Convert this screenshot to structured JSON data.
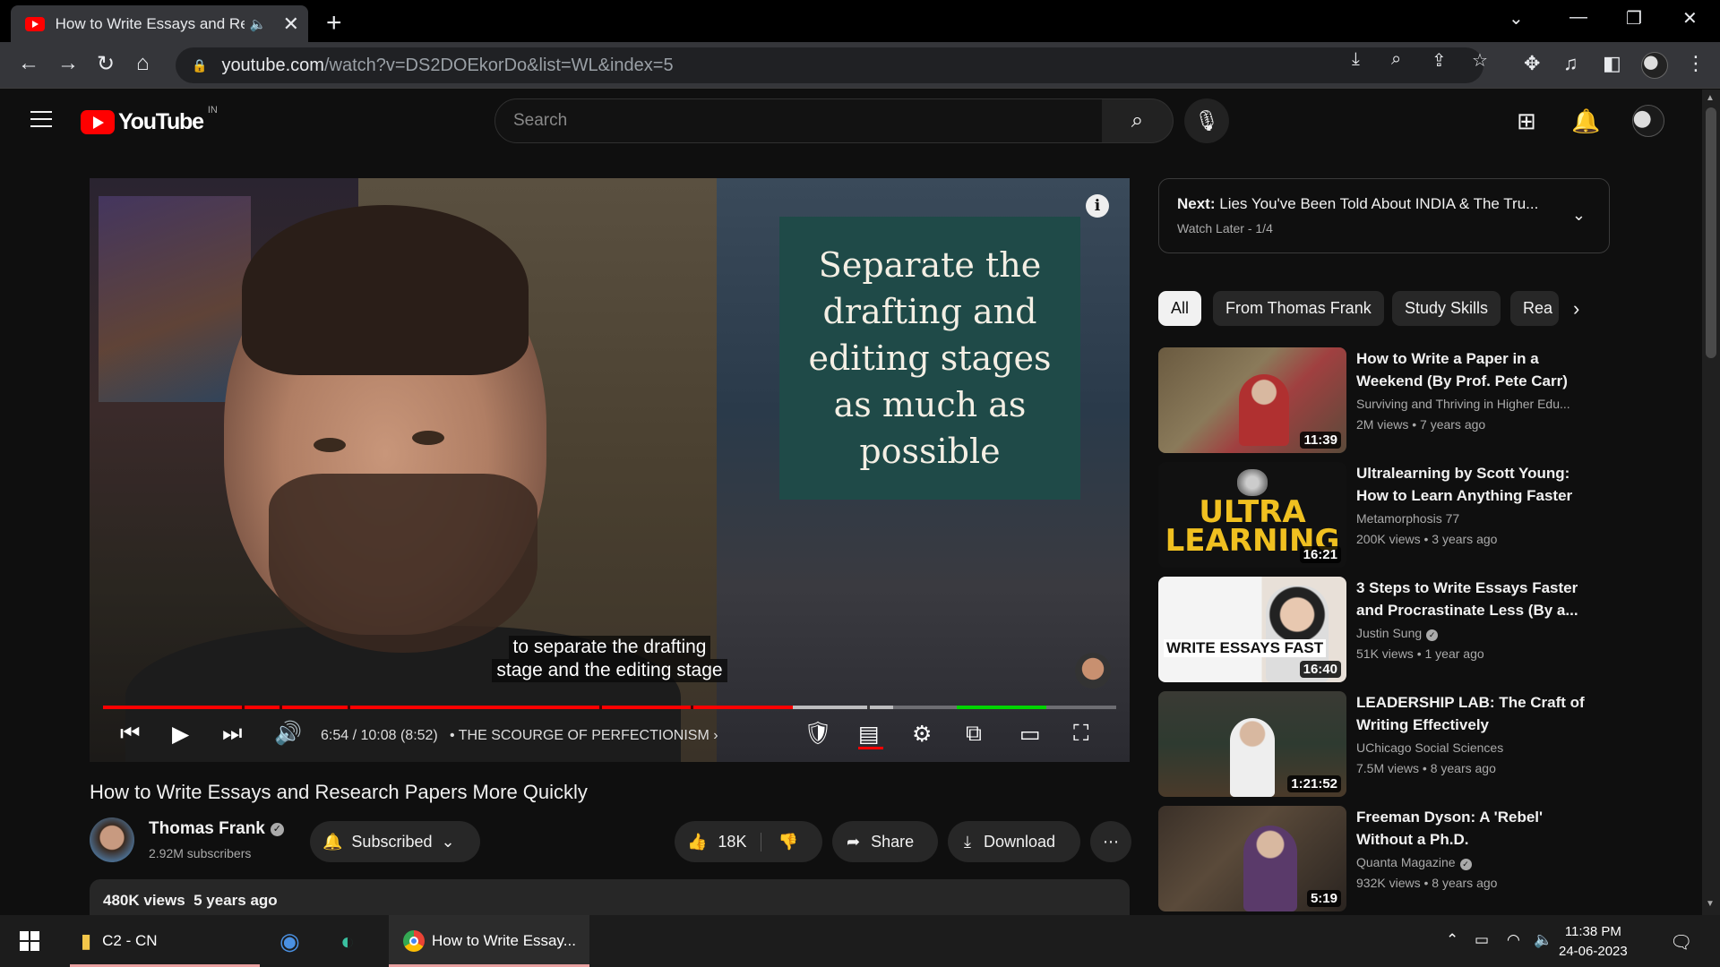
{
  "browser": {
    "tab_title": "How to Write Essays and Resear",
    "url_host": "youtube.com",
    "url_path": "/watch?v=DS2DOEkorDo&list=WL&index=5"
  },
  "youtube": {
    "logo_text": "YouTube",
    "country_code": "IN",
    "search_placeholder": "Search"
  },
  "player": {
    "quote": "Separate the drafting and editing stages as much as possible",
    "caption_line1": "to separate the drafting",
    "caption_line2": "stage and the editing stage",
    "timecode": "6:54 / 10:08 (8:52)",
    "chapter": "• THE SCOURGE OF PERFECTIONISM",
    "progress_fraction": 0.681,
    "loaded_fraction": 0.78
  },
  "video": {
    "title": "How to Write Essays and Research Papers More Quickly",
    "channel": "Thomas Frank",
    "subscribers": "2.92M subscribers",
    "subscribed_label": "Subscribed",
    "likes": "18K",
    "share_label": "Share",
    "download_label": "Download",
    "views_age": "480K views  5 years ago"
  },
  "playlist": {
    "next_prefix": "Next:",
    "next_title": "Lies You've Been Told About INDIA & The Tru...",
    "sub": "Watch Later - 1/4"
  },
  "chips": [
    "All",
    "From Thomas Frank",
    "Study Skills",
    "Rea"
  ],
  "recommendations": [
    {
      "title": "How to Write a Paper in a Weekend (By Prof. Pete Carr)",
      "channel": "Surviving and Thriving in Higher Edu...",
      "meta": "2M views  • 7 years ago",
      "duration": "11:39"
    },
    {
      "title": "Ultralearning by Scott Young: How to Learn Anything Faster",
      "channel": "Metamorphosis 77",
      "meta": "200K views  • 3 years ago",
      "duration": "16:21",
      "thumb_text": "ULTRA LEARNING"
    },
    {
      "title": "3 Steps to Write Essays Faster and Procrastinate Less (By a...",
      "channel": "Justin Sung",
      "meta": "51K views  • 1 year ago",
      "duration": "16:40",
      "thumb_text": "WRITE ESSAYS FAST"
    },
    {
      "title": "LEADERSHIP LAB: The Craft of Writing Effectively",
      "channel": "UChicago Social Sciences",
      "meta": "7.5M views  • 8 years ago",
      "duration": "1:21:52"
    },
    {
      "title": "Freeman Dyson: A 'Rebel' Without a Ph.D.",
      "channel": "Quanta Magazine",
      "meta": "932K views  • 8 years ago",
      "duration": "5:19"
    }
  ],
  "taskbar": {
    "explorer_label": "C2 - CN",
    "chrome_label": "How to Write Essay...",
    "time": "11:38 PM",
    "date": "24-06-2023"
  },
  "colors": {
    "accent_red": "#ff0000",
    "page_bg": "#0f0f0f",
    "quote_card": "#1f4a48"
  }
}
